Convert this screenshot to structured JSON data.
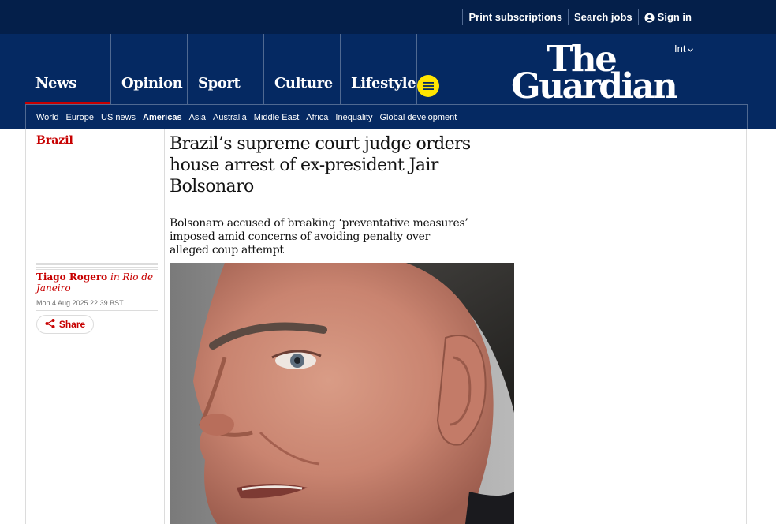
{
  "topbar": {
    "print_subscriptions": "Print subscriptions",
    "search_jobs": "Search jobs",
    "sign_in": "Sign in"
  },
  "header": {
    "edition": "Int",
    "logo_line1": "The",
    "logo_line2": "Guardian",
    "pillars": [
      {
        "label": "News",
        "active": true
      },
      {
        "label": "Opinion",
        "active": false
      },
      {
        "label": "Sport",
        "active": false
      },
      {
        "label": "Culture",
        "active": false
      },
      {
        "label": "Lifestyle",
        "active": false
      }
    ],
    "subnav": [
      "World",
      "Europe",
      "US news",
      "Americas",
      "Asia",
      "Australia",
      "Middle East",
      "Africa",
      "Inequality",
      "Global development"
    ],
    "subnav_active": "Americas"
  },
  "article": {
    "section": "Brazil",
    "headline": "Brazil’s supreme court judge orders house arrest of ex-president Jair Bolsonaro",
    "standfirst": "Bolsonaro accused of breaking ‘preventative measures’ imposed amid concerns of avoiding penalty over alleged coup attempt",
    "author": "Tiago Rogero",
    "location": "in Rio de Janeiro",
    "timestamp": "Mon 4 Aug 2025 22.39 BST",
    "share_label": "Share"
  },
  "colors": {
    "brand_dark": "#041f4a",
    "brand": "#052962",
    "news_red": "#c70000",
    "menu_yellow": "#ffe500"
  }
}
